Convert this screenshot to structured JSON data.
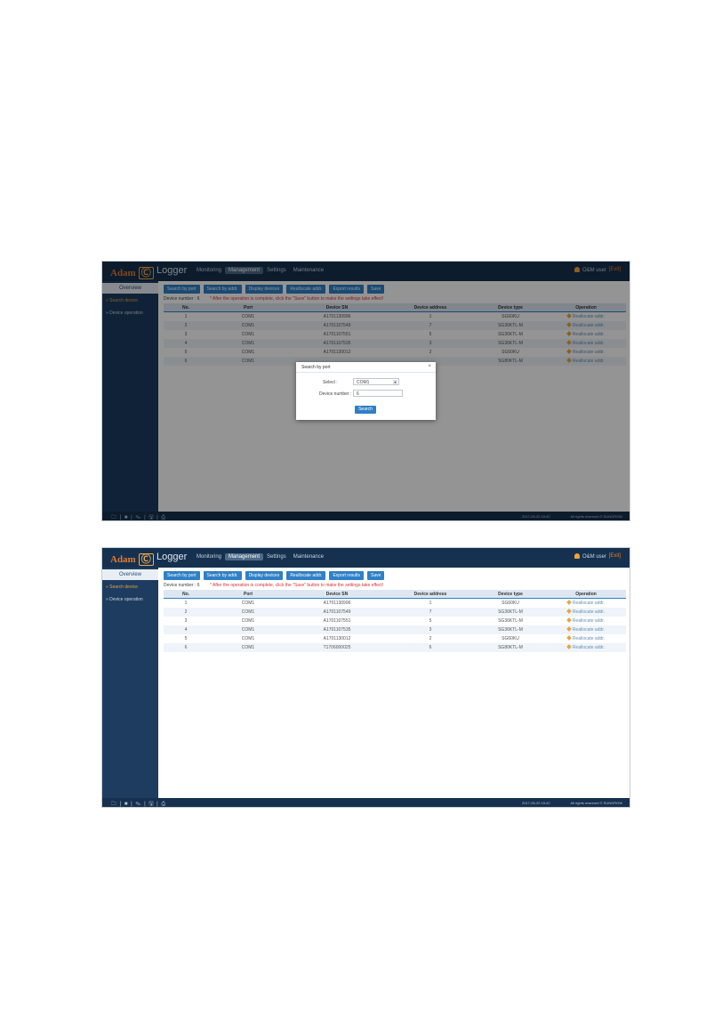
{
  "app": {
    "brand": "Adam",
    "brand_mark": "Ⓒ",
    "product": "Logger",
    "nav": [
      "Monitoring",
      "Management",
      "Settings",
      "Maintenance"
    ],
    "user": "O&M user",
    "exit": "[Exit]"
  },
  "sidebar": {
    "overview": "Overview",
    "items": [
      "» Search device",
      "» Device operation"
    ]
  },
  "toolbar": [
    "Search by port",
    "Search by addr.",
    "Display devices",
    "Reallocate addr.",
    "Export results",
    "Save"
  ],
  "device_line": {
    "label": "Device number :",
    "count": "6",
    "note": "* After the operation is complete, click the \"Save\" button to make the settings take effect!"
  },
  "table": {
    "headers": [
      "No.",
      "Port",
      "Device SN",
      "Device address",
      "Device type",
      "Operation"
    ],
    "op_label": "Reallocate addr."
  },
  "shot1_rows": [
    [
      "1",
      "COM1",
      "A1701130996",
      "1",
      "SG60KU"
    ],
    [
      "2",
      "COM1",
      "A1701107549",
      "7",
      "SG36KTL-M"
    ],
    [
      "3",
      "COM1",
      "A1701107551",
      "5",
      "SG36KTL-M"
    ],
    [
      "4",
      "COM1",
      "A1701107535",
      "3",
      "SG36KTL-M"
    ],
    [
      "5",
      "COM1",
      "A1701130012",
      "2",
      "SG60KU"
    ],
    [
      "6",
      "COM1",
      "",
      "",
      "SG80KTL-M"
    ]
  ],
  "shot2_rows": [
    [
      "1",
      "COM1",
      "A1701130996",
      "1",
      "SG60KU"
    ],
    [
      "2",
      "COM1",
      "A1701107549",
      "7",
      "SG36KTL-M"
    ],
    [
      "3",
      "COM1",
      "A1701107551",
      "5",
      "SG36KTL-M"
    ],
    [
      "4",
      "COM1",
      "A1701107535",
      "3",
      "SG36KTL-M"
    ],
    [
      "5",
      "COM1",
      "A1701130012",
      "2",
      "SG60KU"
    ],
    [
      "6",
      "COM1",
      "T1706000025",
      "6",
      "SG80KTL-M"
    ]
  ],
  "dialog": {
    "title": "Search by port",
    "close": "×",
    "select_label": "Select :",
    "select_value": "COM1",
    "number_label": "Device number :",
    "number_value": "6",
    "button": "Search"
  },
  "footer": {
    "icons": "🗀 | ■ | ✎ | 🖫 | ⎙",
    "time": "2017-05-20 15:42",
    "copyright": "All rights reserved © SUNGROW"
  }
}
